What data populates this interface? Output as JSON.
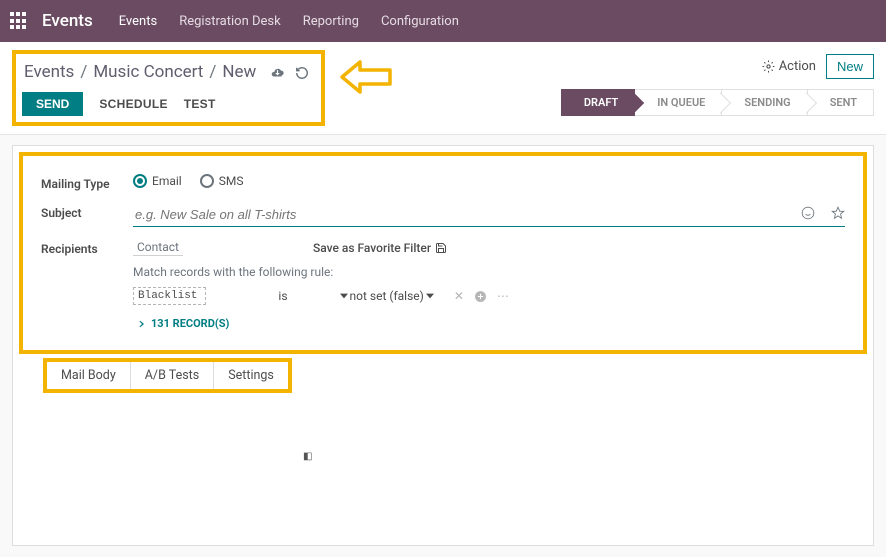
{
  "topbar": {
    "app_title": "Events",
    "menu": [
      "Events",
      "Registration Desk",
      "Reporting",
      "Configuration"
    ]
  },
  "breadcrumbs": {
    "items": [
      "Events",
      "Music Concert",
      "New"
    ]
  },
  "action_buttons": {
    "send": "SEND",
    "schedule": "SCHEDULE",
    "test": "TEST"
  },
  "top_actions": {
    "action_label": "Action",
    "new_label": "New"
  },
  "status_steps": [
    "DRAFT",
    "IN QUEUE",
    "SENDING",
    "SENT"
  ],
  "form": {
    "mailing_type_label": "Mailing Type",
    "mailing_options": {
      "email": "Email",
      "sms": "SMS"
    },
    "subject_label": "Subject",
    "subject_placeholder": "e.g. New Sale on all T-shirts",
    "recipients_label": "Recipients",
    "recipients_model": "Contact",
    "save_filter": "Save as Favorite Filter",
    "match_text": "Match records with the following rule:",
    "rule": {
      "field": "Blacklist",
      "op": "is",
      "value": "not set (false)"
    },
    "record_count": "131 RECORD(S)"
  },
  "tabs": [
    "Mail Body",
    "A/B Tests",
    "Settings"
  ]
}
